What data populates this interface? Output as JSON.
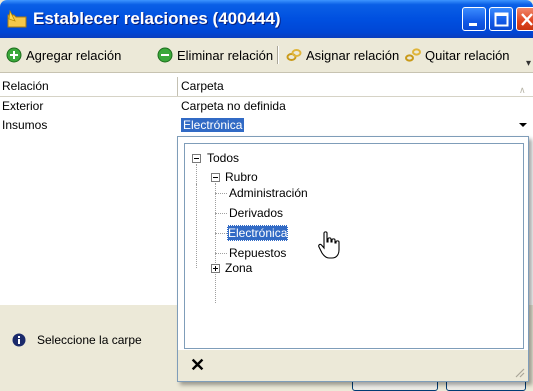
{
  "window": {
    "title": "Establecer relaciones (400444)"
  },
  "toolbar": {
    "items": [
      {
        "label": "Agregar relación",
        "icon": "add-green-circle-icon"
      },
      {
        "label": "Eliminar relación",
        "icon": "remove-green-circle-icon"
      },
      {
        "label": "Asignar relación",
        "icon": "link-chain-icon"
      },
      {
        "label": "Quitar relación",
        "icon": "unlink-chain-icon"
      }
    ]
  },
  "grid": {
    "columns": [
      "Relación",
      "Carpeta"
    ],
    "rows": [
      {
        "relacion": "Exterior",
        "carpeta": "Carpeta no definida"
      },
      {
        "relacion": "Insumos",
        "carpeta": "Electrónica"
      }
    ]
  },
  "tree": {
    "root": "Todos",
    "rubro": "Rubro",
    "rubro_children": [
      "Administración",
      "Derivados",
      "Electrónica",
      "Repuestos"
    ],
    "zona": "Zona",
    "selected": "Electrónica"
  },
  "status": {
    "message": "Seleccione la carpe"
  },
  "colors": {
    "titlebar": "#0050e0",
    "selection": "#316ac5",
    "chrome": "#ece9d8"
  }
}
